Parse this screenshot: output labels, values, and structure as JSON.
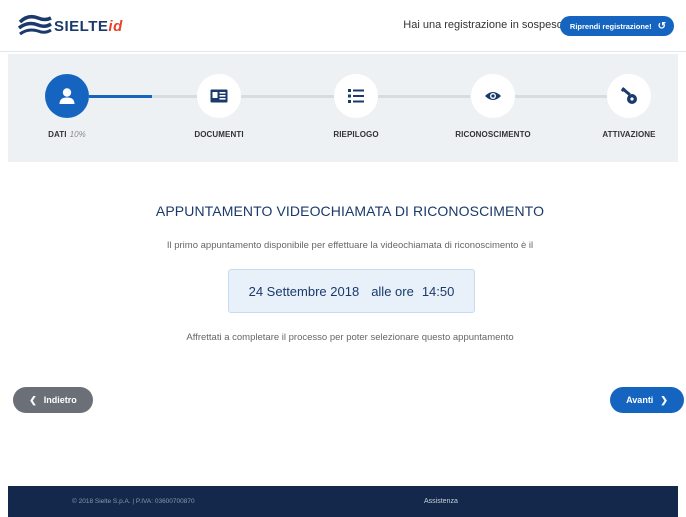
{
  "header": {
    "logo_text": "SIELTE",
    "logo_suffix": "id",
    "pending_text": "Hai una registrazione in sospeso?",
    "resume_label": "Riprendi registrazione!"
  },
  "stepper": {
    "steps": [
      {
        "label": "DATI",
        "progress": "10%",
        "icon": "user-icon",
        "active": true
      },
      {
        "label": "DOCUMENTI",
        "icon": "id-card-icon",
        "active": false
      },
      {
        "label": "RIEPILOGO",
        "icon": "list-icon",
        "active": false
      },
      {
        "label": "RICONOSCIMENTO",
        "icon": "eye-icon",
        "active": false
      },
      {
        "label": "ATTIVAZIONE",
        "icon": "key-icon",
        "active": false
      }
    ]
  },
  "main": {
    "title": "APPUNTAMENTO VIDEOCHIAMATA DI RICONOSCIMENTO",
    "subtitle": "Il primo appuntamento disponibile per effettuare la videochiamata di riconoscimento è il",
    "date": "24 Settembre 2018",
    "time_prefix": "alle ore",
    "time": "14:50",
    "hurry_text": "Affrettati a completare il processo per poter selezionare questo appuntamento"
  },
  "nav": {
    "back_label": "Indietro",
    "next_label": "Avanti"
  },
  "footer": {
    "copyright": "© 2018 Sielte S.p.A. | P.IVA: 03600700870",
    "assistance": "Assistenza"
  },
  "colors": {
    "primary": "#1565c0",
    "navy": "#1a3a6b",
    "footer_bg": "#13284a",
    "stepper_bg": "#eef1f4"
  }
}
